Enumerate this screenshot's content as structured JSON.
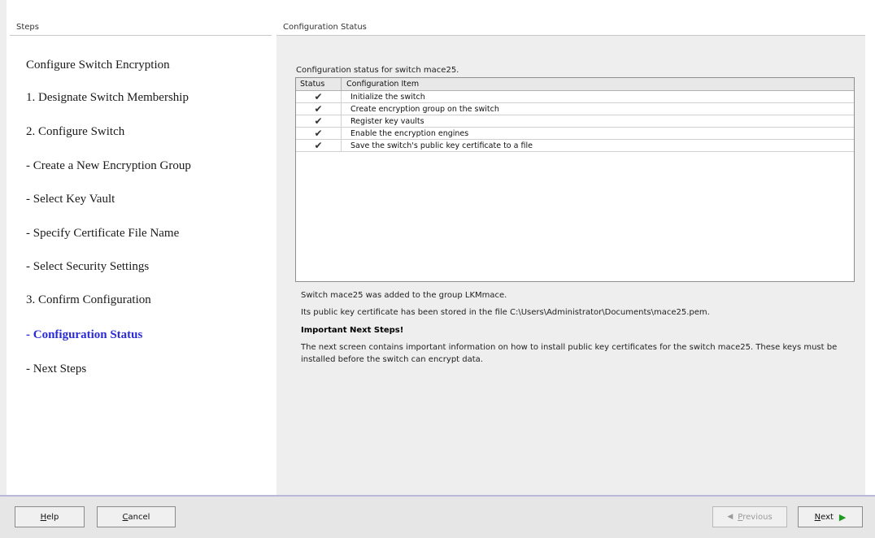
{
  "steps_panel": {
    "header": "Steps",
    "items": [
      {
        "label": "Configure Switch Encryption",
        "active": false
      },
      {
        "label": "1. Designate Switch Membership",
        "active": false
      },
      {
        "label": "2. Configure Switch",
        "active": false
      },
      {
        "label": "- Create a New Encryption Group",
        "active": false
      },
      {
        "label": "- Select Key Vault",
        "active": false
      },
      {
        "label": "- Specify Certificate File Name",
        "active": false
      },
      {
        "label": "- Select Security Settings",
        "active": false
      },
      {
        "label": "3. Confirm Configuration",
        "active": false
      },
      {
        "label": "- Configuration Status",
        "active": true
      },
      {
        "label": "- Next Steps",
        "active": false
      }
    ]
  },
  "content": {
    "header": "Configuration Status",
    "intro": "Configuration status for switch mace25.",
    "table": {
      "columns": [
        "Status",
        "Configuration Item"
      ],
      "rows": [
        {
          "status": "✔",
          "item": "Initialize the switch"
        },
        {
          "status": "✔",
          "item": "Create encryption group on the switch"
        },
        {
          "status": "✔",
          "item": "Register key vaults"
        },
        {
          "status": "✔",
          "item": "Enable the encryption engines"
        },
        {
          "status": "✔",
          "item": "Save the switch's public key certificate to a file"
        }
      ]
    },
    "message_added": "Switch mace25 was added to the group LKMmace.",
    "message_stored": "Its public key certificate has been stored in the file C:\\Users\\Administrator\\Documents\\mace25.pem.",
    "important_title": "Important Next Steps!",
    "important_text": "The next screen contains important information on how to install public key certificates for the switch mace25. These keys must be installed before the switch can encrypt data."
  },
  "buttons": {
    "help_prefix": "",
    "help_u": "H",
    "help_rest": "elp",
    "cancel_u": "C",
    "cancel_rest": "ancel",
    "previous_u": "P",
    "previous_rest": "revious",
    "next_u": "N",
    "next_rest": "ext"
  },
  "colors": {
    "active_step": "#2b2bd6",
    "next_arrow": "#1e9a1e"
  },
  "icons": {
    "check": "check-icon",
    "next": "arrow-right-icon",
    "previous": "arrow-left-icon"
  }
}
